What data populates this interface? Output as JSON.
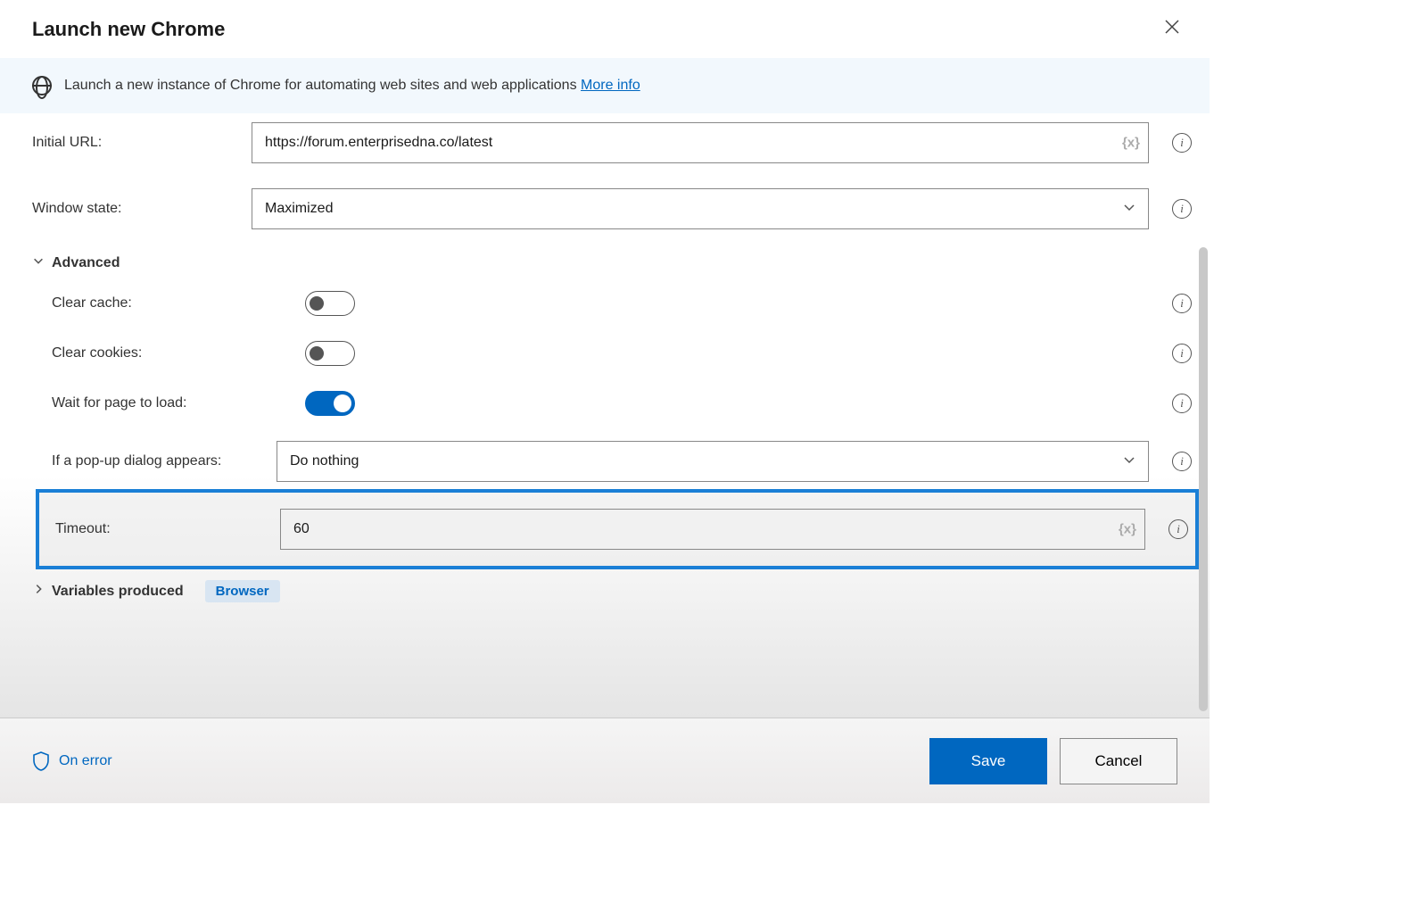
{
  "header": {
    "title": "Launch new Chrome"
  },
  "banner": {
    "text": "Launch a new instance of Chrome for automating web sites and web applications ",
    "link": "More info"
  },
  "fields": {
    "initial_url_label": "Initial URL:",
    "initial_url_value": "https://forum.enterprisedna.co/latest",
    "window_state_label": "Window state:",
    "window_state_value": "Maximized",
    "advanced_label": "Advanced",
    "clear_cache_label": "Clear cache:",
    "clear_cache_on": false,
    "clear_cookies_label": "Clear cookies:",
    "clear_cookies_on": false,
    "wait_page_label": "Wait for page to load:",
    "wait_page_on": true,
    "popup_label": "If a pop-up dialog appears:",
    "popup_value": "Do nothing",
    "timeout_label": "Timeout:",
    "timeout_value": "60",
    "vars_produced_label": "Variables produced",
    "vars_produced_value": "Browser"
  },
  "footer": {
    "on_error": "On error",
    "save": "Save",
    "cancel": "Cancel"
  },
  "glyphs": {
    "var": "{x}"
  }
}
